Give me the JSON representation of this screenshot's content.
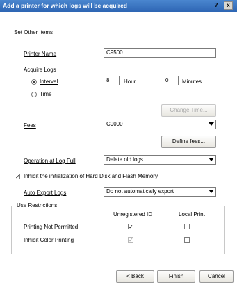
{
  "window": {
    "title": "Add a printer for which logs will be acquired",
    "help": "?",
    "close": "x"
  },
  "section": {
    "label": "Set Other Items"
  },
  "printer_name": {
    "label": "Printer Name",
    "value": "C9500"
  },
  "acquire_logs": {
    "label": "Acquire Logs",
    "interval_label": "Interval",
    "time_label": "Time",
    "hour_value": "8",
    "hour_unit": "Hour",
    "minutes_value": "0",
    "minutes_unit": "Minutes",
    "change_time_button": "Change Time..."
  },
  "fees": {
    "label": "Fees",
    "value": "C9000",
    "define_button": "Define fees..."
  },
  "operation_full": {
    "label": "Operation at Log Full",
    "value": "Delete old logs"
  },
  "inhibit_init": {
    "label": "Inhibit the initialization of Hard Disk and Flash Memory",
    "check": "✓"
  },
  "auto_export": {
    "label": "Auto Export Logs",
    "value": "Do not automatically export"
  },
  "use_restrictions": {
    "title": "Use Restrictions",
    "col_unregistered": "Unregistered ID",
    "col_local_print": "Local Print",
    "rows": [
      {
        "label": "Printing Not Permitted",
        "unregistered": "✓",
        "local": ""
      },
      {
        "label": "Inhibit Color Printing",
        "unregistered": "✓",
        "local": ""
      }
    ]
  },
  "buttons": {
    "back": "< Back",
    "finish": "Finish",
    "cancel": "Cancel"
  }
}
